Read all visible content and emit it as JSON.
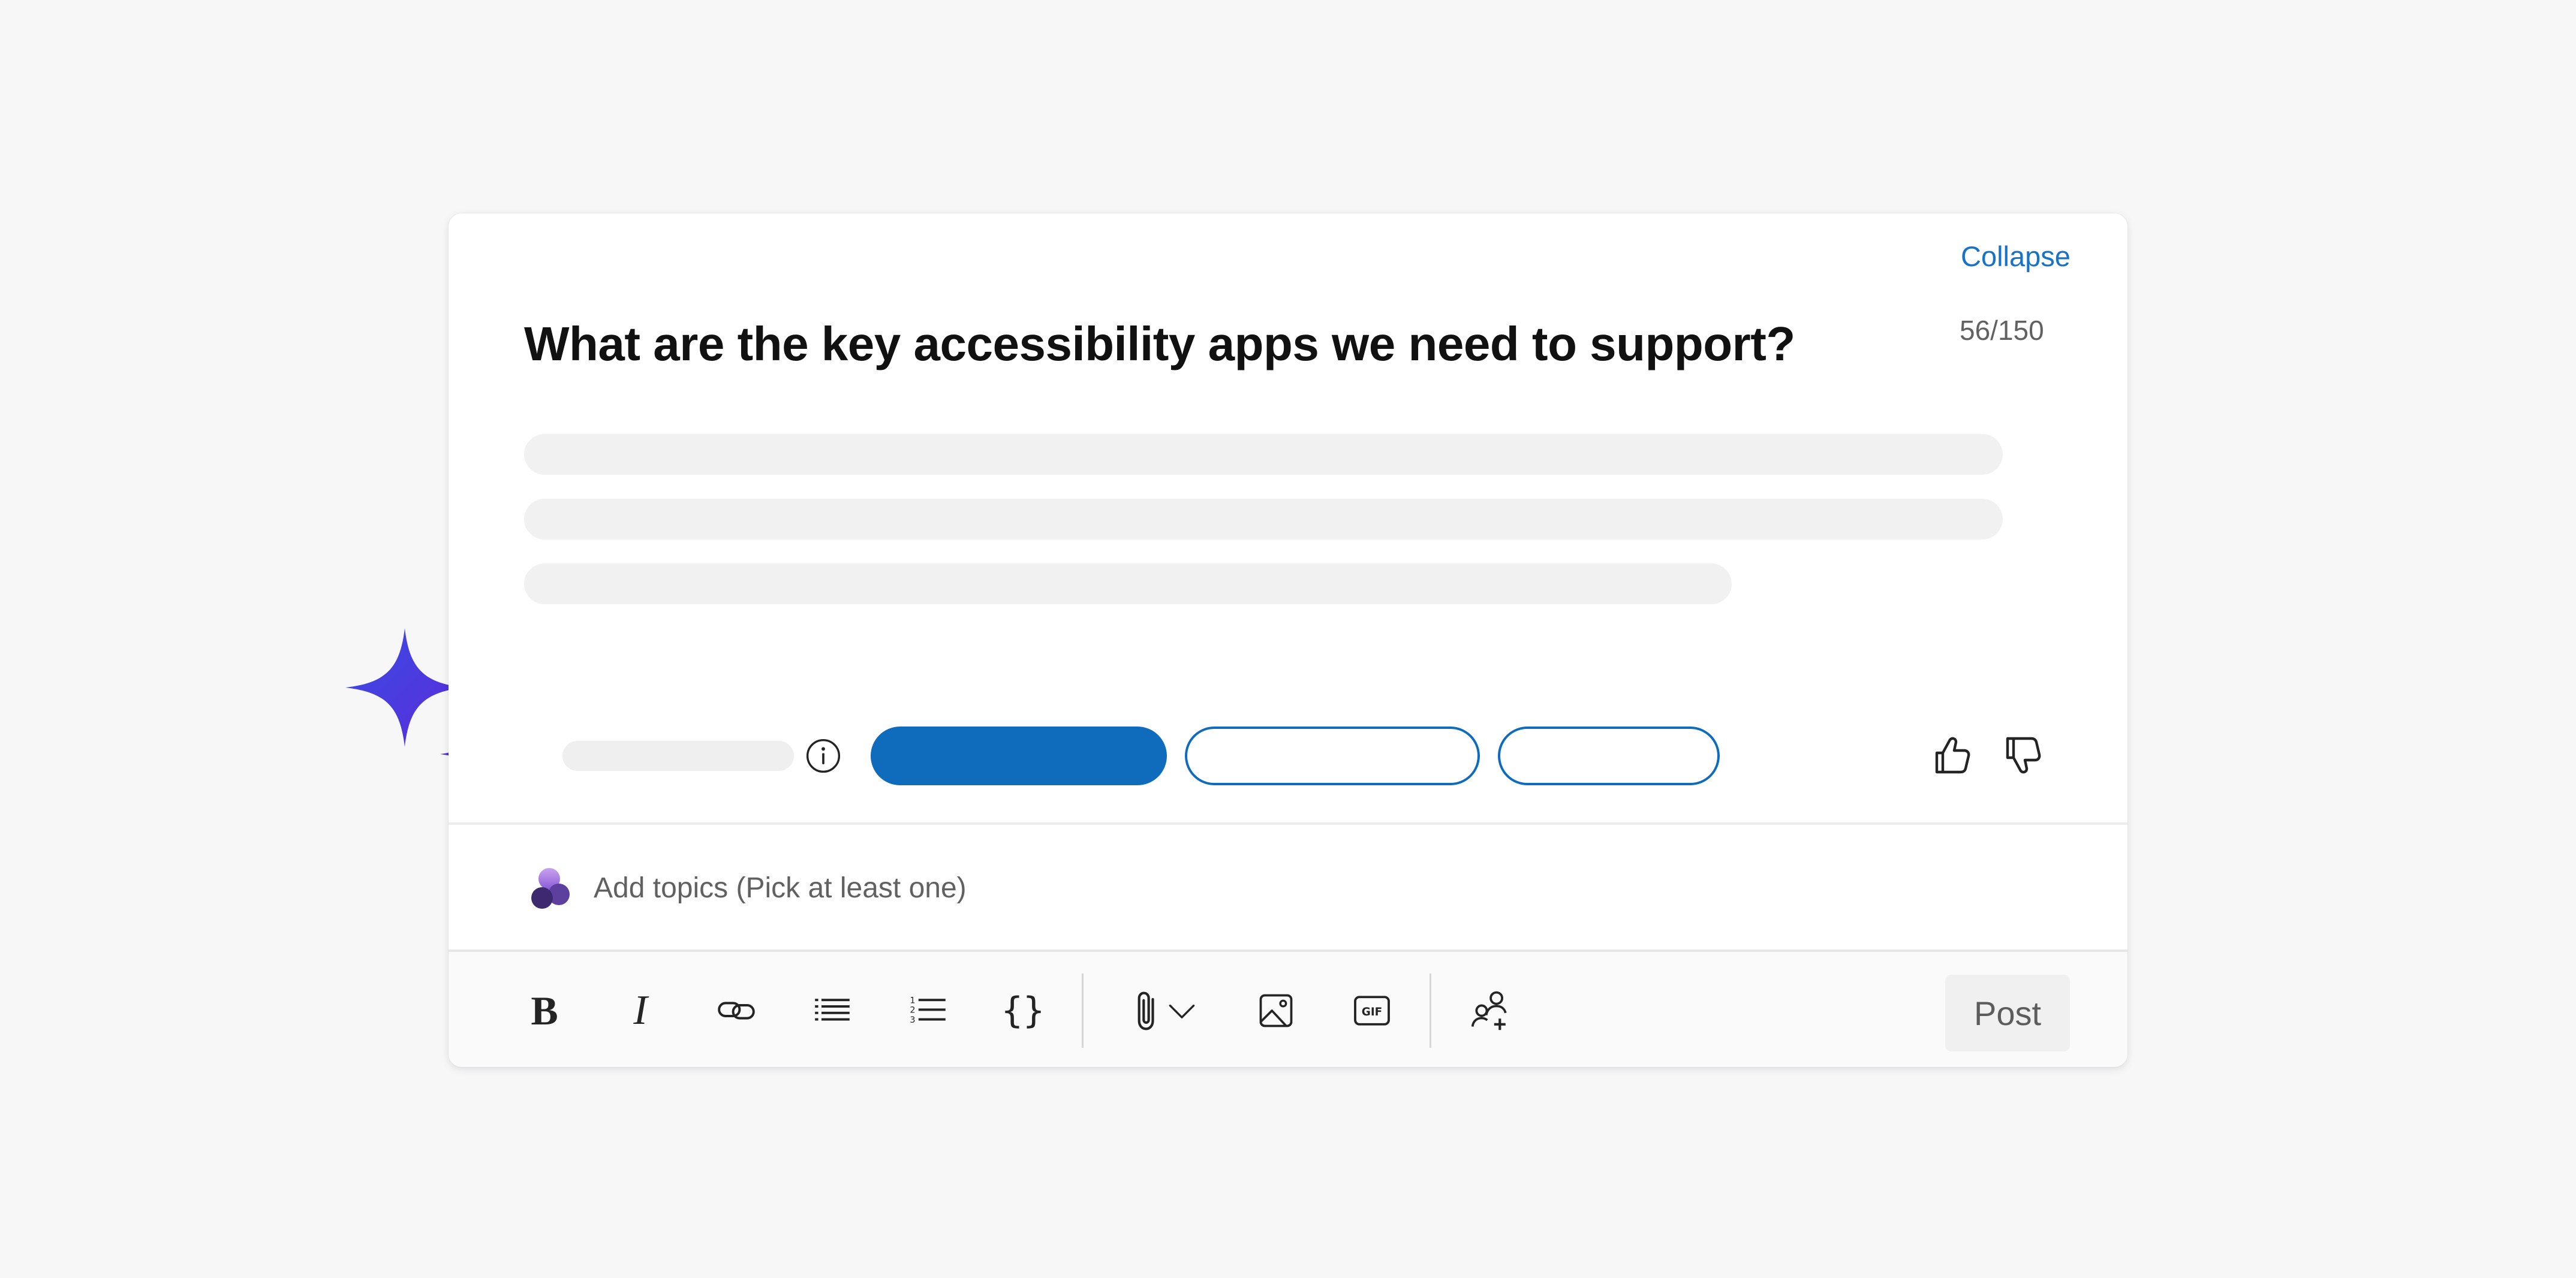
{
  "composer": {
    "collapse_label": "Collapse",
    "char_count": "56/150",
    "question": "What are the key accessibility apps we need to support?"
  },
  "topics": {
    "placeholder": "Add topics (Pick at least one)"
  },
  "toolbar": {
    "post_label": "Post",
    "bold_label": "B",
    "italic_label": "I",
    "code_label": "{}",
    "gif_label": "GIF"
  },
  "colors": {
    "accent": "#0f6cbd",
    "link": "#1673c8",
    "sparkle_start": "#4f46e5",
    "sparkle_end": "#6d28d9",
    "skeleton": "#f1f1f1"
  },
  "icons": {
    "info": "info-icon",
    "thumbs_up": "thumbs-up-icon",
    "thumbs_down": "thumbs-down-icon",
    "topics": "topics-icon",
    "link": "link-icon",
    "bullet_list": "bullet-list-icon",
    "numbered_list": "numbered-list-icon",
    "attach": "paperclip-icon",
    "image": "image-icon",
    "gif": "gif-icon",
    "mention": "add-people-icon",
    "sparkle": "sparkle-icon"
  }
}
